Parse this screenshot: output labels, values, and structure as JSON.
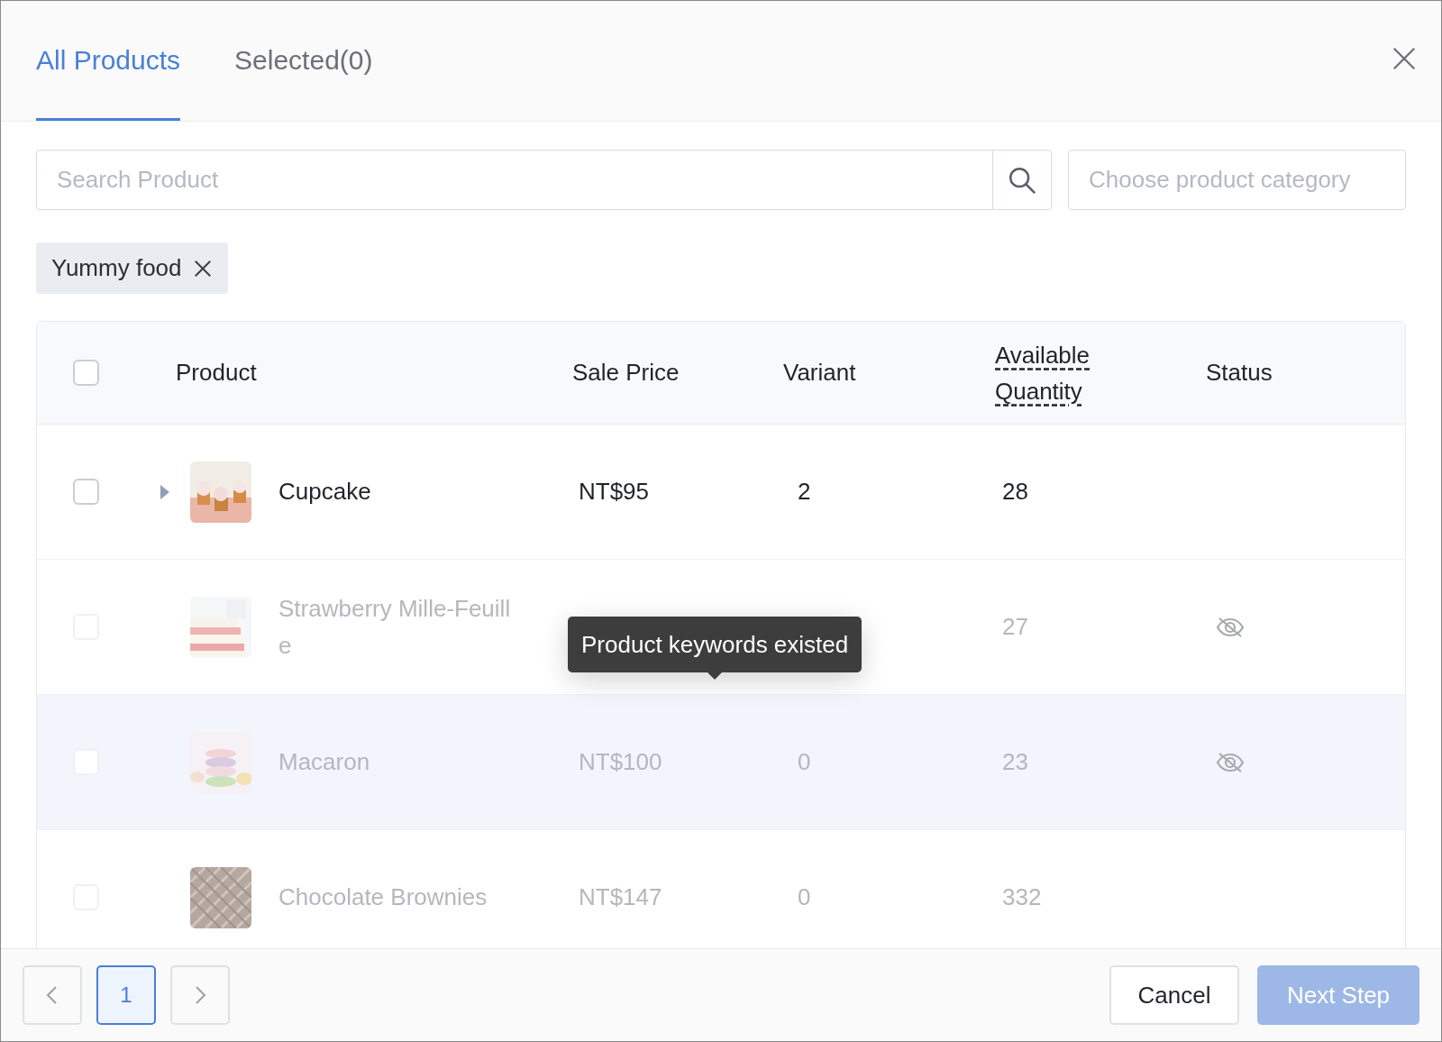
{
  "tabs": [
    {
      "label": "All Products",
      "selected": true
    },
    {
      "label": "Selected(0)",
      "selected": false
    }
  ],
  "search": {
    "placeholder": "Search Product"
  },
  "category": {
    "placeholder": "Choose product category"
  },
  "filter_chips": [
    {
      "label": "Yummy food"
    }
  ],
  "table": {
    "select_all": {
      "checked": false
    },
    "columns": [
      "Product",
      "Sale Price",
      "Variant",
      "Available Quantity",
      "Status"
    ],
    "rows": [
      {
        "product": "Cupcake",
        "sale_price": "NT$95",
        "variant": "2",
        "available_quantity": "28",
        "expandable": true,
        "disabled": false,
        "hidden": false,
        "highlighted": false,
        "checked": false
      },
      {
        "product": "Strawberry Mille-Feuille",
        "available_quantity": "27",
        "expandable": false,
        "disabled": true,
        "hidden": true,
        "highlighted": false,
        "checked": false
      },
      {
        "product": "Macaron",
        "sale_price": "NT$100",
        "variant": "0",
        "available_quantity": "23",
        "expandable": false,
        "disabled": true,
        "hidden": true,
        "highlighted": true,
        "checked": false
      },
      {
        "product": "Chocolate Brownies",
        "sale_price": "NT$147",
        "variant": "0",
        "available_quantity": "332",
        "expandable": false,
        "disabled": true,
        "hidden": false,
        "highlighted": false,
        "checked": false
      }
    ]
  },
  "tooltip": {
    "text": "Product keywords existed"
  },
  "pagination": {
    "pages": [
      {
        "label": "1",
        "selected": true
      }
    ]
  },
  "buttons": [
    {
      "label": "Cancel",
      "disabled": false
    },
    {
      "label": "Next Step",
      "disabled": true
    }
  ]
}
